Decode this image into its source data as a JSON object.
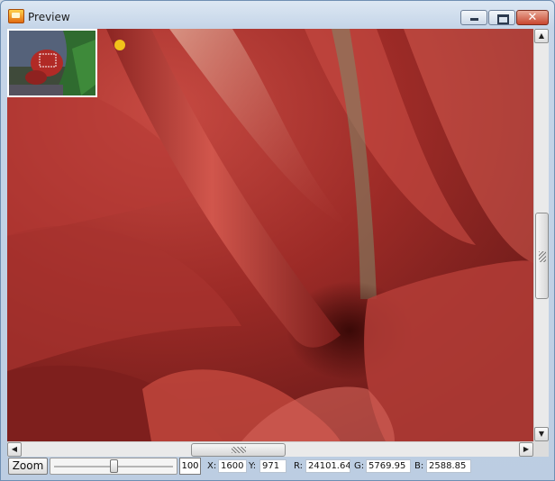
{
  "window": {
    "title": "Preview"
  },
  "titlebar": {
    "app_icon": "app-icon",
    "minimize_icon": "minimize-icon",
    "maximize_icon": "maximize-icon",
    "close_icon": "close-icon",
    "close_glyph": "✕"
  },
  "scrollbars": {
    "up_glyph": "▲",
    "down_glyph": "▼",
    "left_glyph": "◀",
    "right_glyph": "▶",
    "vertical_position": 0.5,
    "horizontal_position": 0.42
  },
  "statusbar": {
    "zoom_label": "Zoom",
    "zoom_value": "100",
    "zoom_slider_fraction": 0.5,
    "x_label": "X:",
    "x_value": "1600",
    "y_label": "Y:",
    "y_value": "971",
    "r_label": "R:",
    "r_value": "24101.64",
    "g_label": "G:",
    "g_value": "5769.95",
    "b_label": "B:",
    "b_value": "2588.85"
  },
  "colors": {
    "accent_red": "#b8312b",
    "window_frame": "#c5d5e8"
  }
}
